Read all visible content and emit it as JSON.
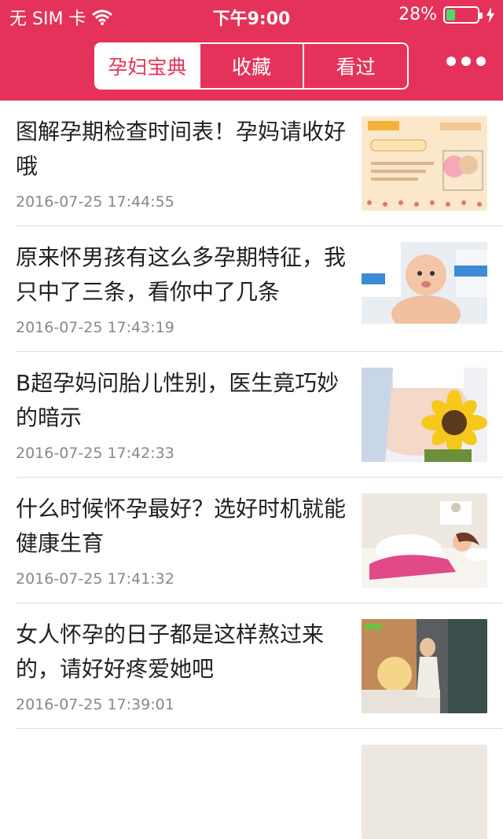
{
  "status": {
    "carrier": "无 SIM 卡",
    "time": "下午9:00",
    "battery": "28%",
    "battery_level": 0.28
  },
  "tabs": [
    {
      "label": "孕妇宝典",
      "active": true
    },
    {
      "label": "收藏",
      "active": false
    },
    {
      "label": "看过",
      "active": false
    }
  ],
  "colors": {
    "brand": "#e5325a",
    "accent": "#4cd964"
  },
  "articles": [
    {
      "title": "图解孕期检查时间表！孕妈请收好哦",
      "time": "2016-07-25 17:44:55"
    },
    {
      "title": "原来怀男孩有这么多孕期特征，我只中了三条，看你中了几条",
      "time": "2016-07-25 17:43:19"
    },
    {
      "title": "B超孕妈问胎儿性别，医生竟巧妙的暗示",
      "time": "2016-07-25 17:42:33"
    },
    {
      "title": "什么时候怀孕最好？选好时机就能健康生育",
      "time": "2016-07-25 17:41:32"
    },
    {
      "title": "女人怀孕的日子都是这样熬过来的，请好好疼爱她吧",
      "time": "2016-07-25 17:39:01"
    }
  ]
}
